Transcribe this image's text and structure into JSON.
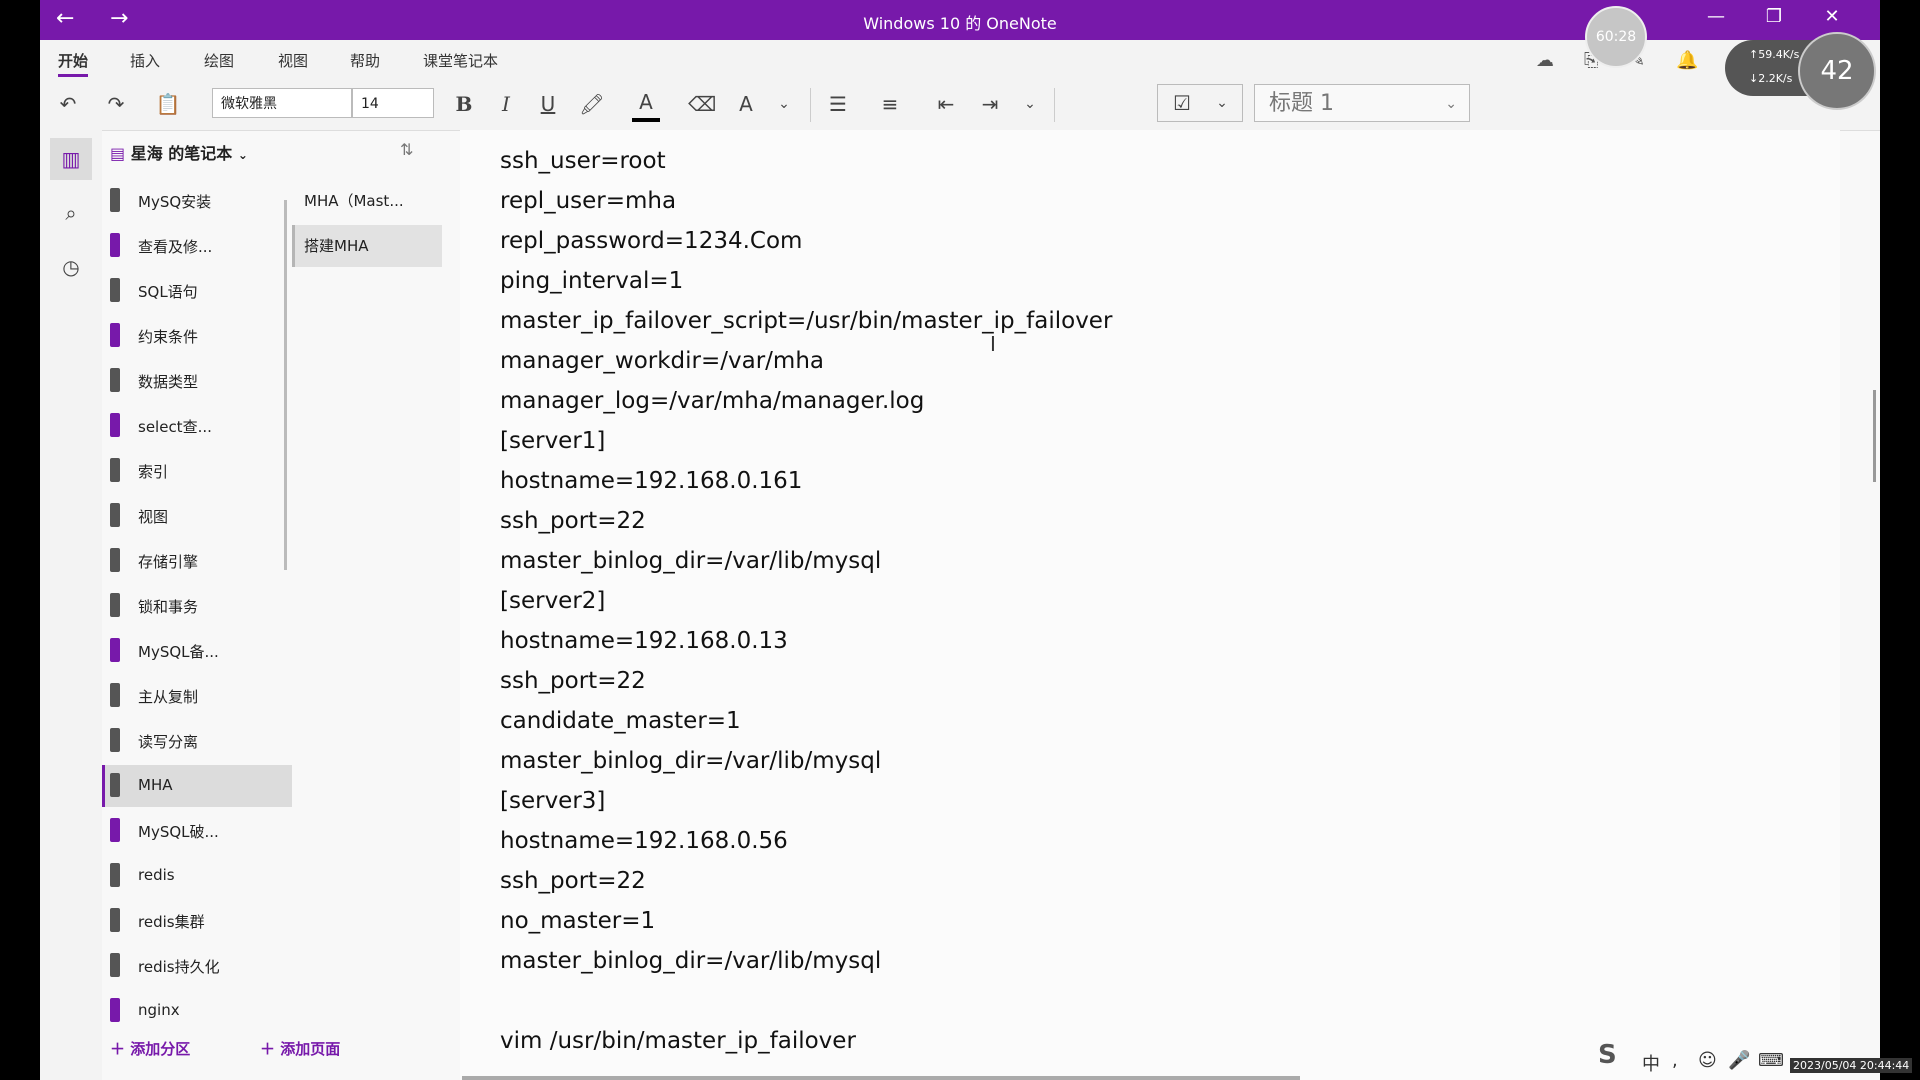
{
  "window": {
    "title": "Windows 10 的 OneNote",
    "back": "←",
    "forward": "→",
    "minimize": "—",
    "restore": "❐",
    "close": "✕",
    "accent": "#7719aa"
  },
  "overlay": {
    "timer": "60:28",
    "net_up": "↑59.4K/s",
    "net_down": "↓2.2K/s",
    "net_value": "42",
    "clock": "2023/05/04 20:44:44"
  },
  "ribbon": {
    "tabs": [
      "开始",
      "插入",
      "绘图",
      "视图",
      "帮助",
      "课堂笔记本"
    ],
    "active_tab": 0
  },
  "toolbar": {
    "font": "微软雅黑",
    "size": "14",
    "bold": "B",
    "italic": "I",
    "underline": "U",
    "style": "标题 1"
  },
  "notebook": {
    "name": "星海 的笔记本"
  },
  "sections": [
    {
      "label": "MySQ安装",
      "color": "#555555"
    },
    {
      "label": "查看及修...",
      "color": "#7719aa"
    },
    {
      "label": "SQL语句",
      "color": "#555555"
    },
    {
      "label": "约束条件",
      "color": "#7719aa"
    },
    {
      "label": "数据类型",
      "color": "#555555"
    },
    {
      "label": "select查...",
      "color": "#7719aa"
    },
    {
      "label": "索引",
      "color": "#555555"
    },
    {
      "label": "视图",
      "color": "#555555"
    },
    {
      "label": "存储引擎",
      "color": "#555555"
    },
    {
      "label": "锁和事务",
      "color": "#555555"
    },
    {
      "label": "MySQL备...",
      "color": "#7719aa"
    },
    {
      "label": "主从复制",
      "color": "#555555"
    },
    {
      "label": "读写分离",
      "color": "#555555"
    },
    {
      "label": "MHA",
      "color": "#555555"
    },
    {
      "label": "MySQL破...",
      "color": "#7719aa"
    },
    {
      "label": "redis",
      "color": "#555555"
    },
    {
      "label": "redis集群",
      "color": "#555555"
    },
    {
      "label": "redis持久化",
      "color": "#555555"
    },
    {
      "label": "nginx",
      "color": "#7719aa"
    }
  ],
  "active_section": 13,
  "pages": [
    {
      "label": "MHA（Mast..."
    },
    {
      "label": "搭建MHA"
    }
  ],
  "active_page": 1,
  "add_section": "添加分区",
  "add_page": "添加页面",
  "content_lines": [
    "ssh_user=root",
    "repl_user=mha",
    "repl_password=1234.Com",
    "ping_interval=1",
    "master_ip_failover_script=/usr/bin/master_ip_failover",
    "manager_workdir=/var/mha",
    "manager_log=/var/mha/manager.log",
    "[server1]",
    "hostname=192.168.0.161",
    "ssh_port=22",
    "master_binlog_dir=/var/lib/mysql",
    "[server2]",
    "hostname=192.168.0.13",
    "ssh_port=22",
    "candidate_master=1",
    "master_binlog_dir=/var/lib/mysql",
    "[server3]",
    "hostname=192.168.0.56",
    "ssh_port=22",
    "no_master=1",
    "master_binlog_dir=/var/lib/mysql",
    "",
    "vim /usr/bin/master_ip_failover"
  ],
  "tray": {
    "ime": "中"
  }
}
